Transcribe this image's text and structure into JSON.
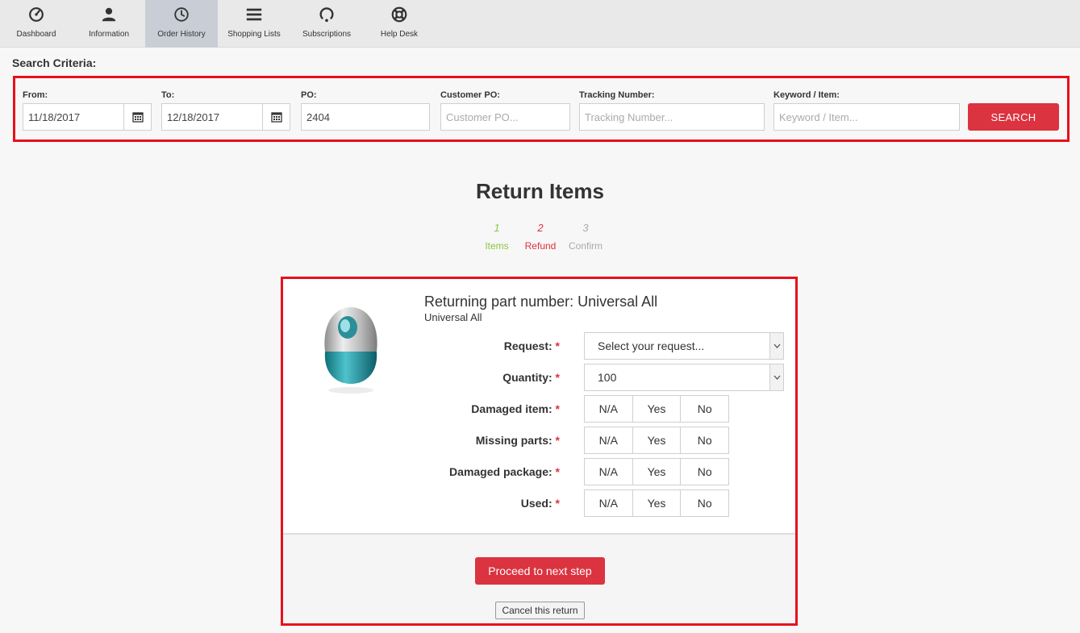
{
  "nav": {
    "items": [
      {
        "label": "Dashboard",
        "icon": "dashboard-gauge-icon"
      },
      {
        "label": "Information",
        "icon": "user-icon"
      },
      {
        "label": "Order History",
        "icon": "clock-icon",
        "active": true
      },
      {
        "label": "Shopping Lists",
        "icon": "list-icon"
      },
      {
        "label": "Subscriptions",
        "icon": "subscription-refresh-icon"
      },
      {
        "label": "Help Desk",
        "icon": "lifebuoy-icon"
      }
    ]
  },
  "search": {
    "title": "Search Criteria:",
    "from_label": "From:",
    "from_value": "11/18/2017",
    "to_label": "To:",
    "to_value": "12/18/2017",
    "po_label": "PO:",
    "po_value": "2404",
    "customer_po_label": "Customer PO:",
    "customer_po_placeholder": "Customer PO...",
    "tracking_label": "Tracking Number:",
    "tracking_placeholder": "Tracking Number...",
    "keyword_label": "Keyword / Item:",
    "keyword_placeholder": "Keyword / Item...",
    "search_button": "SEARCH"
  },
  "page": {
    "title": "Return Items",
    "steps": [
      {
        "num": "1",
        "label": "Items"
      },
      {
        "num": "2",
        "label": "Refund"
      },
      {
        "num": "3",
        "label": "Confirm"
      }
    ]
  },
  "return_form": {
    "part_title": "Returning part number: Universal All",
    "part_subtitle": "Universal All",
    "request_label": "Request:",
    "request_value": "Select your request...",
    "quantity_label": "Quantity:",
    "quantity_value": "100",
    "required_mark": "*",
    "toggle_options": [
      "N/A",
      "Yes",
      "No"
    ],
    "toggle_rows": [
      {
        "label": "Damaged item:"
      },
      {
        "label": "Missing parts:"
      },
      {
        "label": "Damaged package:"
      },
      {
        "label": "Used:"
      }
    ],
    "proceed_button": "Proceed to next step",
    "cancel_button": "Cancel this return"
  },
  "colors": {
    "accent_red": "#db3340",
    "highlight_border": "#e8101b",
    "step_done_green": "#8cc63f",
    "step_pending_gray": "#aaaaaa",
    "nav_active_bg": "#c9ced6"
  }
}
